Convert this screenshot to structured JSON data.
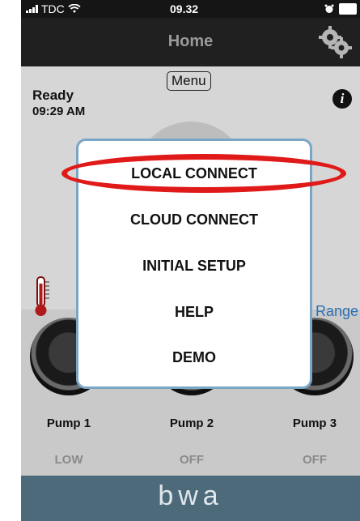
{
  "status_bar": {
    "carrier": "TDC",
    "time": "09.32"
  },
  "header": {
    "title": "Home"
  },
  "status": {
    "state": "Ready",
    "time": "09:29 AM"
  },
  "menu_button": {
    "label": "Menu"
  },
  "info_button": {
    "label": "i"
  },
  "range_label": "Range",
  "popup": {
    "items": [
      "LOCAL CONNECT",
      "CLOUD CONNECT",
      "INITIAL SETUP",
      "HELP",
      "DEMO"
    ],
    "highlighted_item": "LOCAL CONNECT"
  },
  "pumps": [
    {
      "name": "Pump 1",
      "state": "LOW"
    },
    {
      "name": "Pump 2",
      "state": "OFF"
    },
    {
      "name": "Pump 3",
      "state": "OFF"
    }
  ],
  "footer": {
    "brand": "bwa"
  },
  "colors": {
    "accent_blue": "#7aa6c6",
    "highlight_red": "#e01919",
    "footer_bg": "#4d6a7a"
  }
}
